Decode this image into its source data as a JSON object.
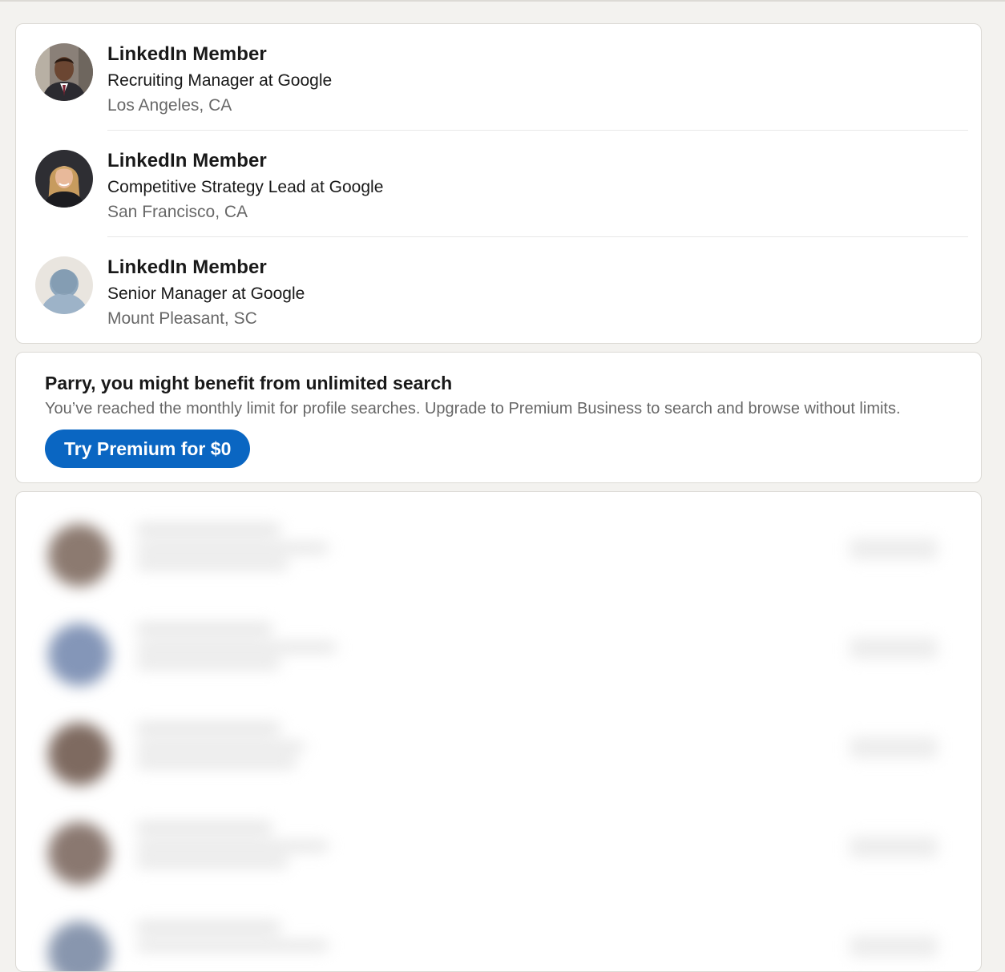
{
  "results": [
    {
      "name": "LinkedIn Member",
      "headline": "Recruiting Manager at Google",
      "location": "Los Angeles, CA",
      "avatar_icon": "profile-photo-man"
    },
    {
      "name": "LinkedIn Member",
      "headline": "Competitive Strategy Lead at Google",
      "location": "San Francisco, CA",
      "avatar_icon": "profile-photo-woman"
    },
    {
      "name": "LinkedIn Member",
      "headline": "Senior Manager at Google",
      "location": "Mount Pleasant, SC",
      "avatar_icon": "default-avatar-icon"
    }
  ],
  "premium": {
    "title": "Parry, you might benefit from unlimited search",
    "description": "You’ve reached the monthly limit for profile searches. Upgrade to Premium Business to search and browse without limits.",
    "button_label": "Try Premium for $0"
  },
  "colors": {
    "primary_blue": "#0a66c2",
    "page_background": "#f3f2ef",
    "card_background": "#ffffff"
  }
}
